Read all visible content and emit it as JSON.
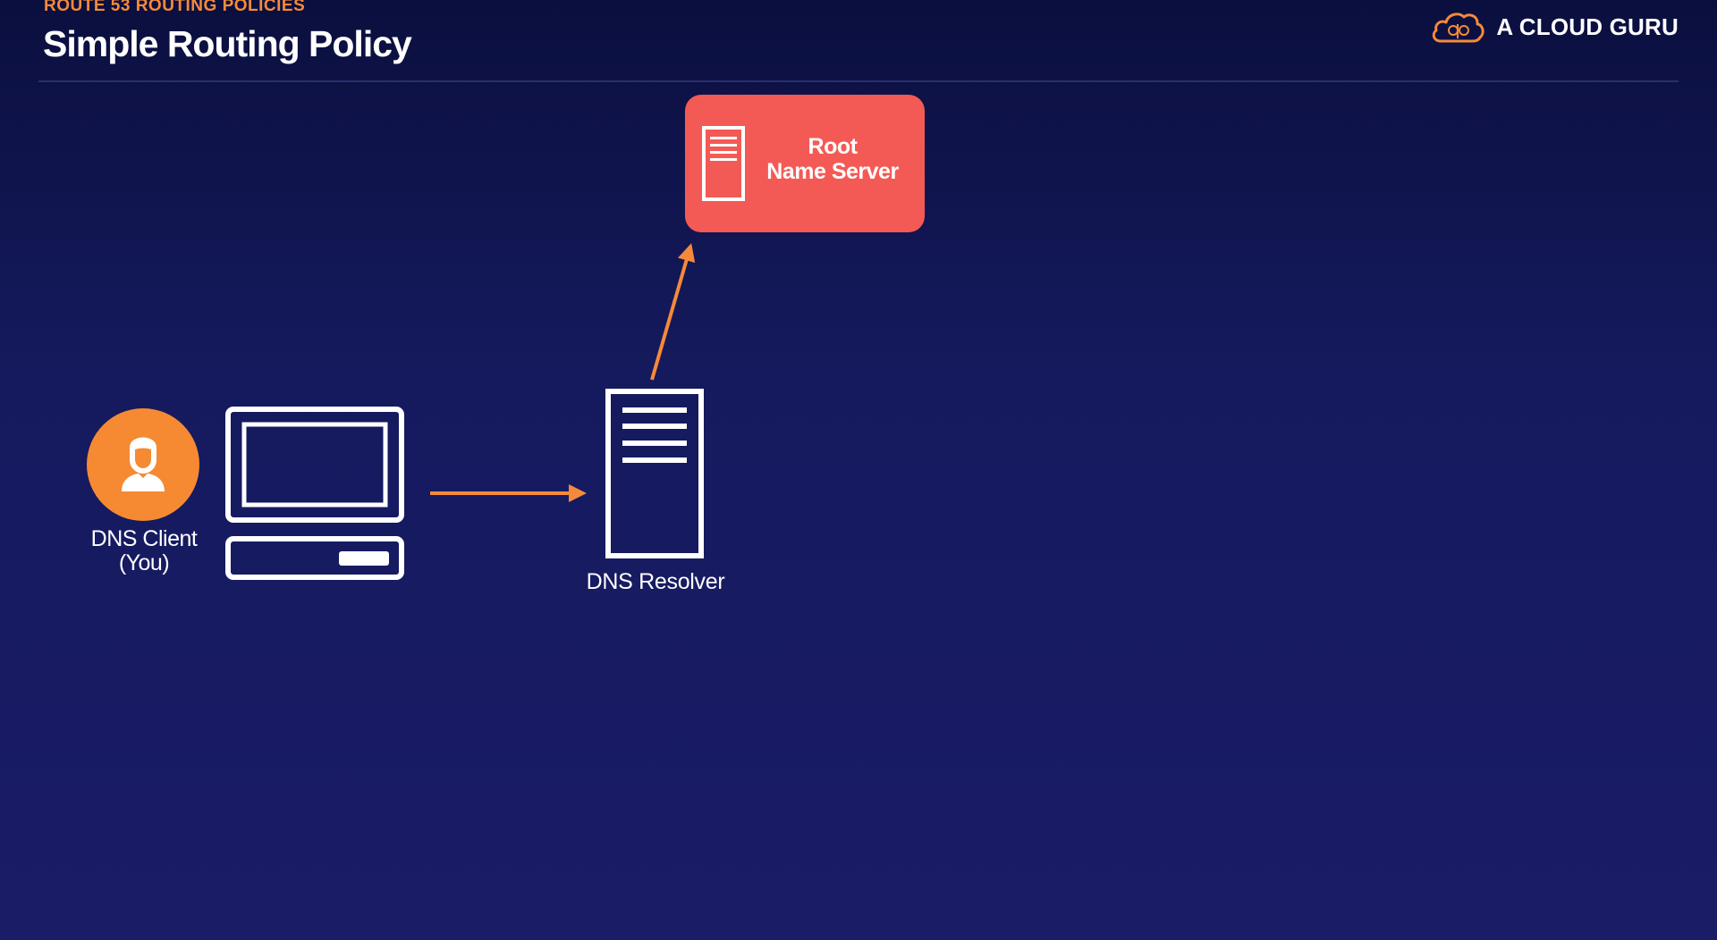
{
  "header": {
    "kicker": "ROUTE 53 ROUTING POLICIES",
    "title": "Simple Routing Policy"
  },
  "brand": {
    "name": "A CLOUD GURU",
    "icon": "cloud-logo-icon"
  },
  "diagram": {
    "root_server": {
      "line1": "Root",
      "line2": "Name Server",
      "icon": "server-icon",
      "color": "#f45a55"
    },
    "client": {
      "line1": "DNS Client",
      "line2": "(You)",
      "icon": "user-icon",
      "color": "#f58a33"
    },
    "computer": {
      "icon": "computer-icon"
    },
    "resolver": {
      "label": "DNS Resolver",
      "icon": "server-icon"
    },
    "arrows": [
      {
        "from": "computer",
        "to": "resolver"
      },
      {
        "from": "resolver",
        "to": "root_server"
      }
    ],
    "accent_color": "#f58a3b",
    "background_color": "#151a5e"
  }
}
